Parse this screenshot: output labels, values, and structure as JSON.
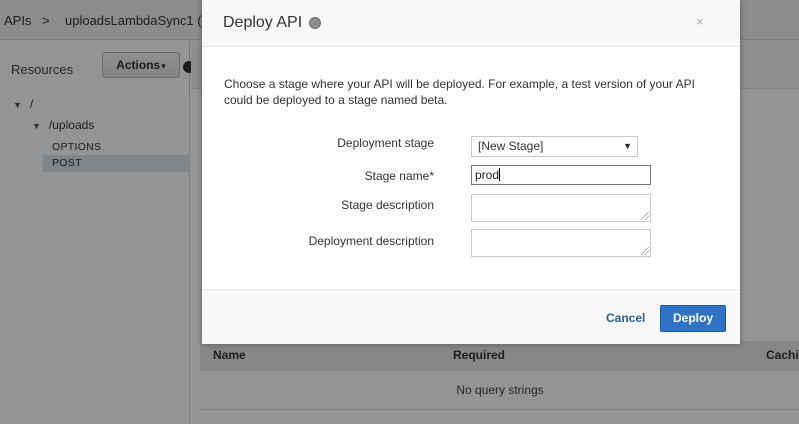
{
  "breadcrumb": {
    "apis": "APIs",
    "separator": ">",
    "api_name": "uploadsLambdaSync1 (i"
  },
  "sidebar": {
    "resources_label": "Resources",
    "actions_label": "Actions",
    "tree": {
      "root": "/",
      "uploads": "/uploads",
      "methods": [
        "OPTIONS",
        "POST"
      ],
      "selected_method": "POST"
    }
  },
  "query_strings": {
    "columns": [
      "Name",
      "Required",
      "Cachi"
    ],
    "empty_text": "No query strings"
  },
  "modal": {
    "title": "Deploy API",
    "close_symbol": "×",
    "intro_text": "Choose a stage where your API will be deployed. For example, a test version of your API could be deployed to a stage named beta.",
    "fields": {
      "deployment_stage": {
        "label": "Deployment stage",
        "value": "[New Stage]"
      },
      "stage_name": {
        "label": "Stage name*",
        "value": "prod"
      },
      "stage_description": {
        "label": "Stage description",
        "value": ""
      },
      "deployment_description": {
        "label": "Deployment description",
        "value": ""
      }
    },
    "cancel_label": "Cancel",
    "deploy_label": "Deploy"
  },
  "colors": {
    "deploy_button": "#2e73c6",
    "cancel_link": "#2a5f97",
    "overlay": "rgba(0,0,0,0.42)"
  }
}
